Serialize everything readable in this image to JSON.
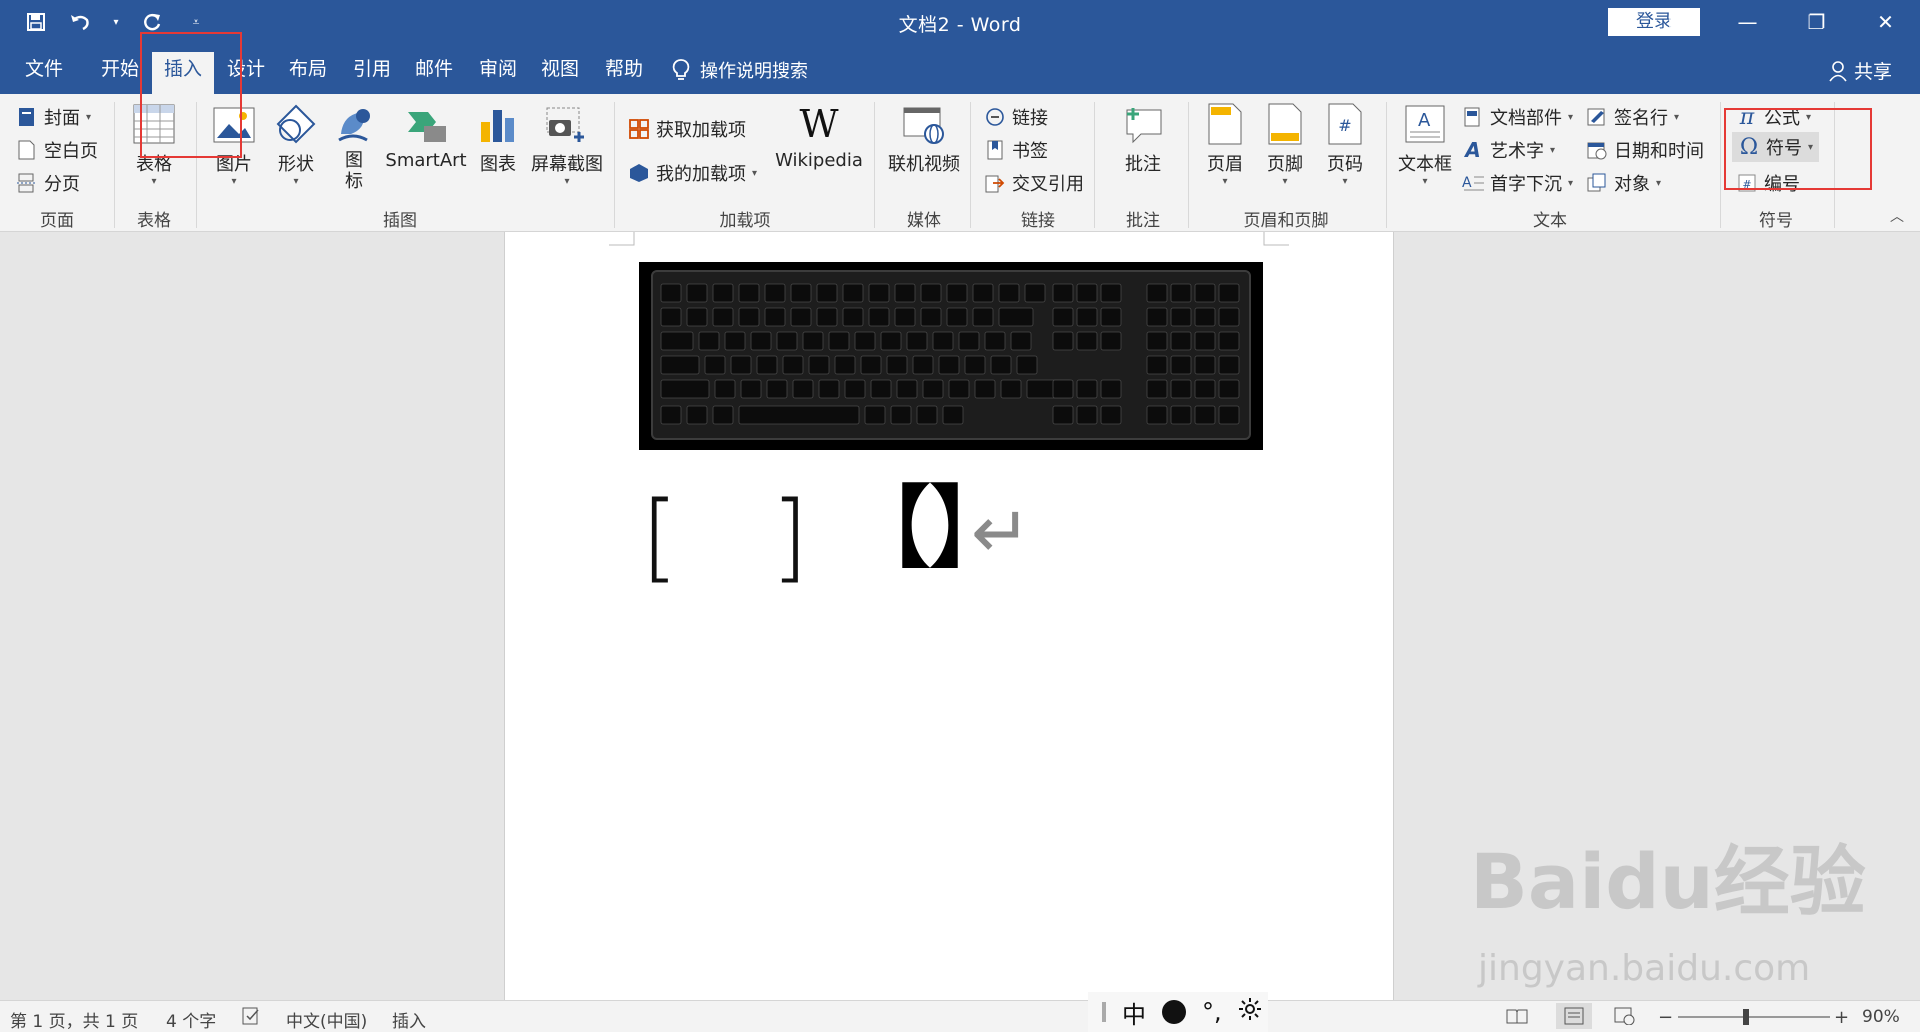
{
  "window": {
    "title": "文档2  -  Word",
    "login_label": "登录"
  },
  "quick_access": {
    "icons": [
      "save-icon",
      "undo-icon",
      "redo-icon",
      "customize-icon"
    ]
  },
  "tabs": [
    {
      "label": "文件"
    },
    {
      "label": "开始"
    },
    {
      "label": "插入"
    },
    {
      "label": "设计"
    },
    {
      "label": "布局"
    },
    {
      "label": "引用"
    },
    {
      "label": "邮件"
    },
    {
      "label": "审阅"
    },
    {
      "label": "视图"
    },
    {
      "label": "帮助"
    }
  ],
  "active_tab": "插入",
  "tell_me": "操作说明搜索",
  "share_label": "共享",
  "ribbon": {
    "pages": {
      "label": "页面",
      "items": [
        "封面",
        "空白页",
        "分页"
      ]
    },
    "table": {
      "label": "表格",
      "button": "表格"
    },
    "illustrations": {
      "label": "插图",
      "buttons": [
        "图片",
        "形状",
        "图标",
        "SmartArt",
        "图表",
        "屏幕截图"
      ]
    },
    "addins": {
      "label": "加载项",
      "get": "获取加载项",
      "my": "我的加载项",
      "wiki": "Wikipedia"
    },
    "media": {
      "label": "媒体",
      "button": "联机视频"
    },
    "links": {
      "label": "链接",
      "items": [
        "链接",
        "书签",
        "交叉引用"
      ]
    },
    "comments": {
      "label": "批注",
      "button": "批注"
    },
    "header_footer": {
      "label": "页眉和页脚",
      "buttons": [
        "页眉",
        "页脚",
        "页码"
      ]
    },
    "text": {
      "label": "文本",
      "textbox": "文本框",
      "col1": [
        "文档部件",
        "艺术字",
        "首字下沉"
      ],
      "col2": [
        "签名行",
        "日期和时间",
        "对象"
      ]
    },
    "symbols": {
      "label": "符号",
      "items": [
        "公式",
        "符号",
        "编号"
      ]
    }
  },
  "document": {
    "brackets_open": "[",
    "brackets_close": "]",
    "lenticular": "【】",
    "return_mark": "↵"
  },
  "statusbar": {
    "page": "第 1 页，共 1 页",
    "words": "4 个字",
    "language": "中文(中国)",
    "mode": "插入",
    "zoom": "90%",
    "zoom_level": 0.9
  },
  "ime": {
    "lang": "中",
    "punct": "°,"
  },
  "watermark": {
    "brand": "Baidu经验",
    "url": "jingyan.baidu.com"
  },
  "colors": {
    "brand": "#2b579a",
    "highlight": "#e53935"
  }
}
